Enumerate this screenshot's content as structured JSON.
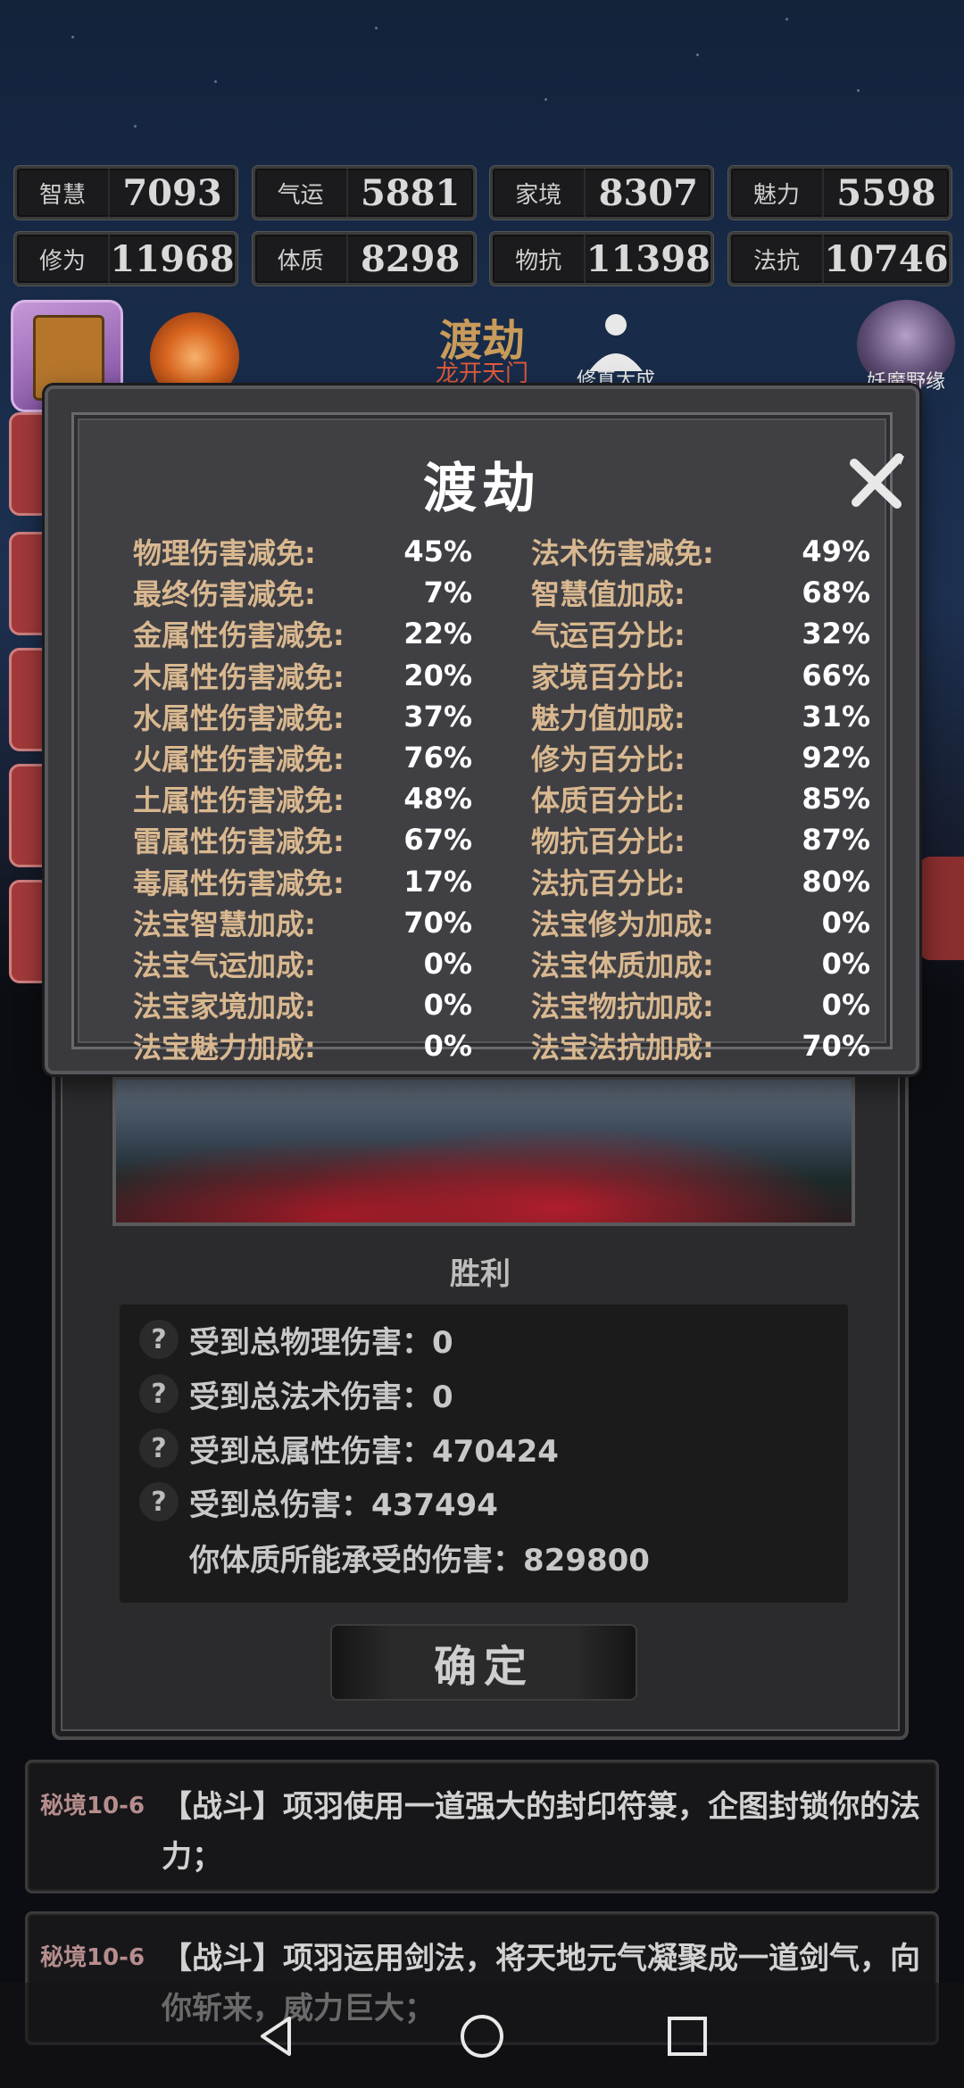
{
  "stats": [
    {
      "label": "智慧",
      "value": "7093"
    },
    {
      "label": "气运",
      "value": "5881"
    },
    {
      "label": "家境",
      "value": "8307"
    },
    {
      "label": "魅力",
      "value": "5598"
    },
    {
      "label": "修为",
      "value": "11968"
    },
    {
      "label": "体质",
      "value": "8298"
    },
    {
      "label": "物抗",
      "value": "11398"
    },
    {
      "label": "法抗",
      "value": "10746"
    }
  ],
  "iconbar": {
    "dujie_title": "渡劫",
    "dujie_subtitle": "龙开天门",
    "meditate_label": "修真大成",
    "portrait_label": "妖魔野缘"
  },
  "modal": {
    "title": "渡劫",
    "close_icon": "close-x-icon",
    "left_attributes": [
      {
        "label": "物理伤害减免:",
        "value": "45%"
      },
      {
        "label": "最终伤害减免:",
        "value": "7%"
      },
      {
        "label": "金属性伤害减免:",
        "value": "22%"
      },
      {
        "label": "木属性伤害减免:",
        "value": "20%"
      },
      {
        "label": "水属性伤害减免:",
        "value": "37%"
      },
      {
        "label": "火属性伤害减免:",
        "value": "76%"
      },
      {
        "label": "土属性伤害减免:",
        "value": "48%"
      },
      {
        "label": "雷属性伤害减免:",
        "value": "67%"
      },
      {
        "label": "毒属性伤害减免:",
        "value": "17%"
      },
      {
        "label": "法宝智慧加成:",
        "value": "70%"
      },
      {
        "label": "法宝气运加成:",
        "value": "0%"
      },
      {
        "label": "法宝家境加成:",
        "value": "0%"
      },
      {
        "label": "法宝魅力加成:",
        "value": "0%"
      }
    ],
    "right_attributes": [
      {
        "label": "法术伤害减免:",
        "value": "49%"
      },
      {
        "label": "智慧值加成:",
        "value": "68%"
      },
      {
        "label": "气运百分比:",
        "value": "32%"
      },
      {
        "label": "家境百分比:",
        "value": "66%"
      },
      {
        "label": "魅力值加成:",
        "value": "31%"
      },
      {
        "label": "修为百分比:",
        "value": "92%"
      },
      {
        "label": "体质百分比:",
        "value": "85%"
      },
      {
        "label": "物抗百分比:",
        "value": "87%"
      },
      {
        "label": "法抗百分比:",
        "value": "80%"
      },
      {
        "label": "法宝修为加成:",
        "value": "0%"
      },
      {
        "label": "法宝体质加成:",
        "value": "0%"
      },
      {
        "label": "法宝物抗加成:",
        "value": "0%"
      },
      {
        "label": "法宝法抗加成:",
        "value": "70%"
      }
    ]
  },
  "result": {
    "title": "胜利",
    "damage_lines": [
      "受到总物理伤害：0",
      "受到总法术伤害：0",
      "受到总属性伤害：470424",
      "受到总伤害：437494"
    ],
    "tolerance_line": "你体质所能承受的伤害：829800",
    "help_glyph": "?",
    "confirm_label": "确定"
  },
  "logs": [
    {
      "tag": "秘境10-6",
      "text": "【战斗】项羽使用一道强大的封印符箓，企图封锁你的法力；"
    },
    {
      "tag": "秘境10-6",
      "text": "【战斗】项羽运用剑法，将天地元气凝聚成一道剑气，向你斩来，威力巨大；"
    }
  ],
  "navbar": {
    "back_icon": "back-triangle-icon",
    "home_icon": "home-circle-icon",
    "recents_icon": "recents-square-icon"
  }
}
